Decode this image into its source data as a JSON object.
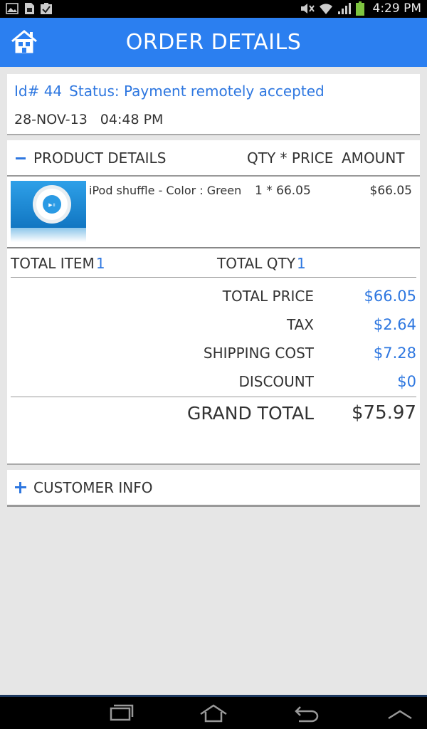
{
  "status_bar": {
    "time": "4:29 PM",
    "left_icons": [
      "image-icon",
      "sim-icon",
      "checkbox-clipboard-icon"
    ],
    "right_icons": [
      "mute-icon",
      "wifi-icon",
      "signal-icon",
      "battery-icon"
    ]
  },
  "app_bar": {
    "title": "ORDER DETAILS",
    "home_icon": "home-icon",
    "color": "#2b7ff0"
  },
  "order": {
    "id_label": "Id# 44",
    "status_label": "Status: Payment remotely accepted",
    "date": "28-NOV-13",
    "time": "04:48 PM"
  },
  "product_section": {
    "toggle_icon": "minus-icon",
    "header": {
      "product": "PRODUCT DETAILS",
      "qty_price": "QTY * PRICE",
      "amount": "AMOUNT"
    },
    "items": [
      {
        "image_icon": "ipod-shuffle-image",
        "name": "iPod shuffle - Color : Green",
        "qty_price": "1 * 66.05",
        "amount": "$66.05"
      }
    ],
    "total_item_label": "TOTAL ITEM",
    "total_item_value": "1",
    "total_qty_label": "TOTAL QTY",
    "total_qty_value": "1",
    "summary": {
      "total_price_label": "TOTAL PRICE",
      "total_price": "$66.05",
      "tax_label": "TAX",
      "tax": "$2.64",
      "shipping_label": "SHIPPING COST",
      "shipping": "$7.28",
      "discount_label": "DISCOUNT",
      "discount": "$0",
      "grand_total_label": "GRAND TOTAL",
      "grand_total": "$75.97"
    }
  },
  "customer_section": {
    "toggle_icon": "plus-icon",
    "label": "CUSTOMER INFO"
  },
  "nav_bar": {
    "buttons": [
      "recent-apps-icon",
      "home-icon",
      "back-icon",
      "menu-up-icon"
    ]
  },
  "colors": {
    "accent": "#2e77e0",
    "background": "#e6e6e6"
  }
}
